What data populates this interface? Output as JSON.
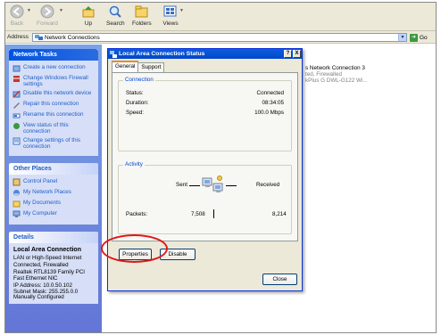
{
  "toolbar": {
    "back_label": "Back",
    "forward_label": "Forward",
    "up_label": "Up",
    "search_label": "Search",
    "folders_label": "Folders",
    "views_label": "Views"
  },
  "address": {
    "label": "Address",
    "value": "Network Connections",
    "go_label": "Go"
  },
  "network_tasks": {
    "title": "Network Tasks",
    "items": [
      {
        "icon": "create-connection-icon",
        "label": "Create a new connection"
      },
      {
        "icon": "firewall-icon",
        "label": "Change Windows Firewall settings"
      },
      {
        "icon": "disable-device-icon",
        "label": "Disable this network device"
      },
      {
        "icon": "repair-icon",
        "label": "Repair this connection"
      },
      {
        "icon": "rename-icon",
        "label": "Rename this connection"
      },
      {
        "icon": "status-icon",
        "label": "View status of this connection"
      },
      {
        "icon": "settings-icon",
        "label": "Change settings of this connection"
      }
    ]
  },
  "other_places": {
    "title": "Other Places",
    "items": [
      {
        "icon": "control-panel-icon",
        "label": "Control Panel"
      },
      {
        "icon": "network-places-icon",
        "label": "My Network Places"
      },
      {
        "icon": "documents-icon",
        "label": "My Documents"
      },
      {
        "icon": "computer-icon",
        "label": "My Computer"
      }
    ]
  },
  "details": {
    "title": "Details",
    "name": "Local Area Connection",
    "lines": [
      "LAN or High-Speed Internet",
      "Connected, Firewalled",
      "Realtek RTL8139 Family PCI Fast Ethernet NIC",
      "IP Address: 10.0.50.102",
      "Subnet Mask: 255.255.0.0",
      "Manually Configured"
    ]
  },
  "connection_item": {
    "name": "s Network Connection 3",
    "status": "ted, Firewalled",
    "device": "kPlus G DWL-G122 Wi..."
  },
  "dialog": {
    "title": "Local Area Connection Status",
    "help_btn": "?",
    "close_btn": "X",
    "tabs": [
      "General",
      "Support"
    ],
    "connection_group": "Connection",
    "status_label": "Status:",
    "status_value": "Connected",
    "duration_label": "Duration:",
    "duration_value": "08:34:05",
    "speed_label": "Speed:",
    "speed_value": "100.0 Mbps",
    "activity_group": "Activity",
    "sent_label": "Sent",
    "received_label": "Received",
    "packets_label": "Packets:",
    "packets_sent": "7,508",
    "packets_received": "8,214",
    "properties_btn": "Properties",
    "disable_btn": "Disable",
    "close_label": "Close"
  },
  "colors": {
    "annotation_ring": "#e01818",
    "titlebar": "#0a5ddf",
    "taskpane": "#6f8de0"
  }
}
